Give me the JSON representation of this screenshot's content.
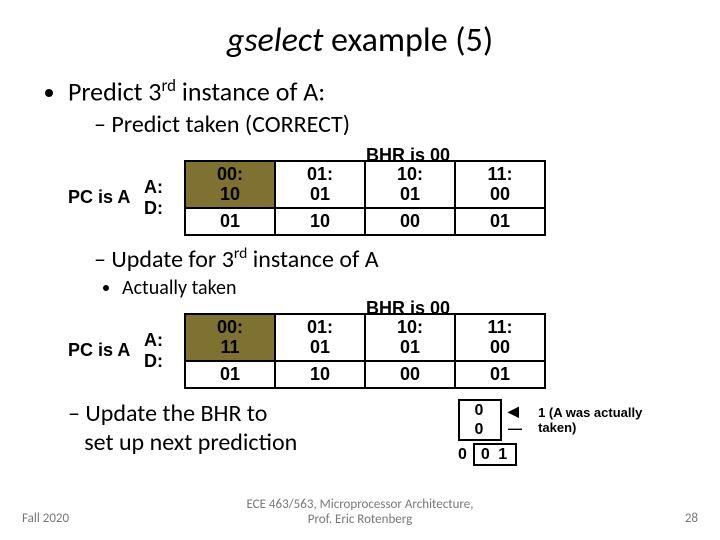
{
  "title_ital": "gselect",
  "title_rest": " example (5)",
  "bullet1_pre": "Predict 3",
  "bullet1_sup": "rd",
  "bullet1_post": " instance of A:",
  "sub1": "Predict taken (CORRECT)",
  "bhr_caption": "BHR is 00",
  "pc_label": "PC is A",
  "rowhdr_A": "A:",
  "rowhdr_D": "D:",
  "cols": {
    "c0": "00:",
    "c1": "01:",
    "c2": "10:",
    "c3": "11:"
  },
  "t1": {
    "r0": {
      "c0": "10",
      "c1": "01",
      "c2": "01",
      "c3": "00"
    },
    "r1": {
      "c0": "01",
      "c1": "10",
      "c2": "00",
      "c3": "01"
    }
  },
  "sub2_pre": "Update for 3",
  "sub2_sup": "rd",
  "sub2_post": " instance of A",
  "sub2b": "Actually taken",
  "t2": {
    "r0": {
      "c0": "11",
      "c1": "01",
      "c2": "01",
      "c3": "00"
    },
    "r1": {
      "c0": "01",
      "c1": "10",
      "c2": "00",
      "c3": "01"
    }
  },
  "sub3a": "Update the BHR to",
  "sub3b": "set up next prediction",
  "bhr_old": "0 0",
  "bhr_shift_in": "0",
  "bhr_new": "0 1",
  "bhr_note": "1 (A was actually taken)",
  "footer_left": "Fall 2020",
  "footer_center_l1": "ECE 463/563, Microprocessor Architecture,",
  "footer_center_l2": "Prof. Eric Rotenberg",
  "footer_right": "28"
}
